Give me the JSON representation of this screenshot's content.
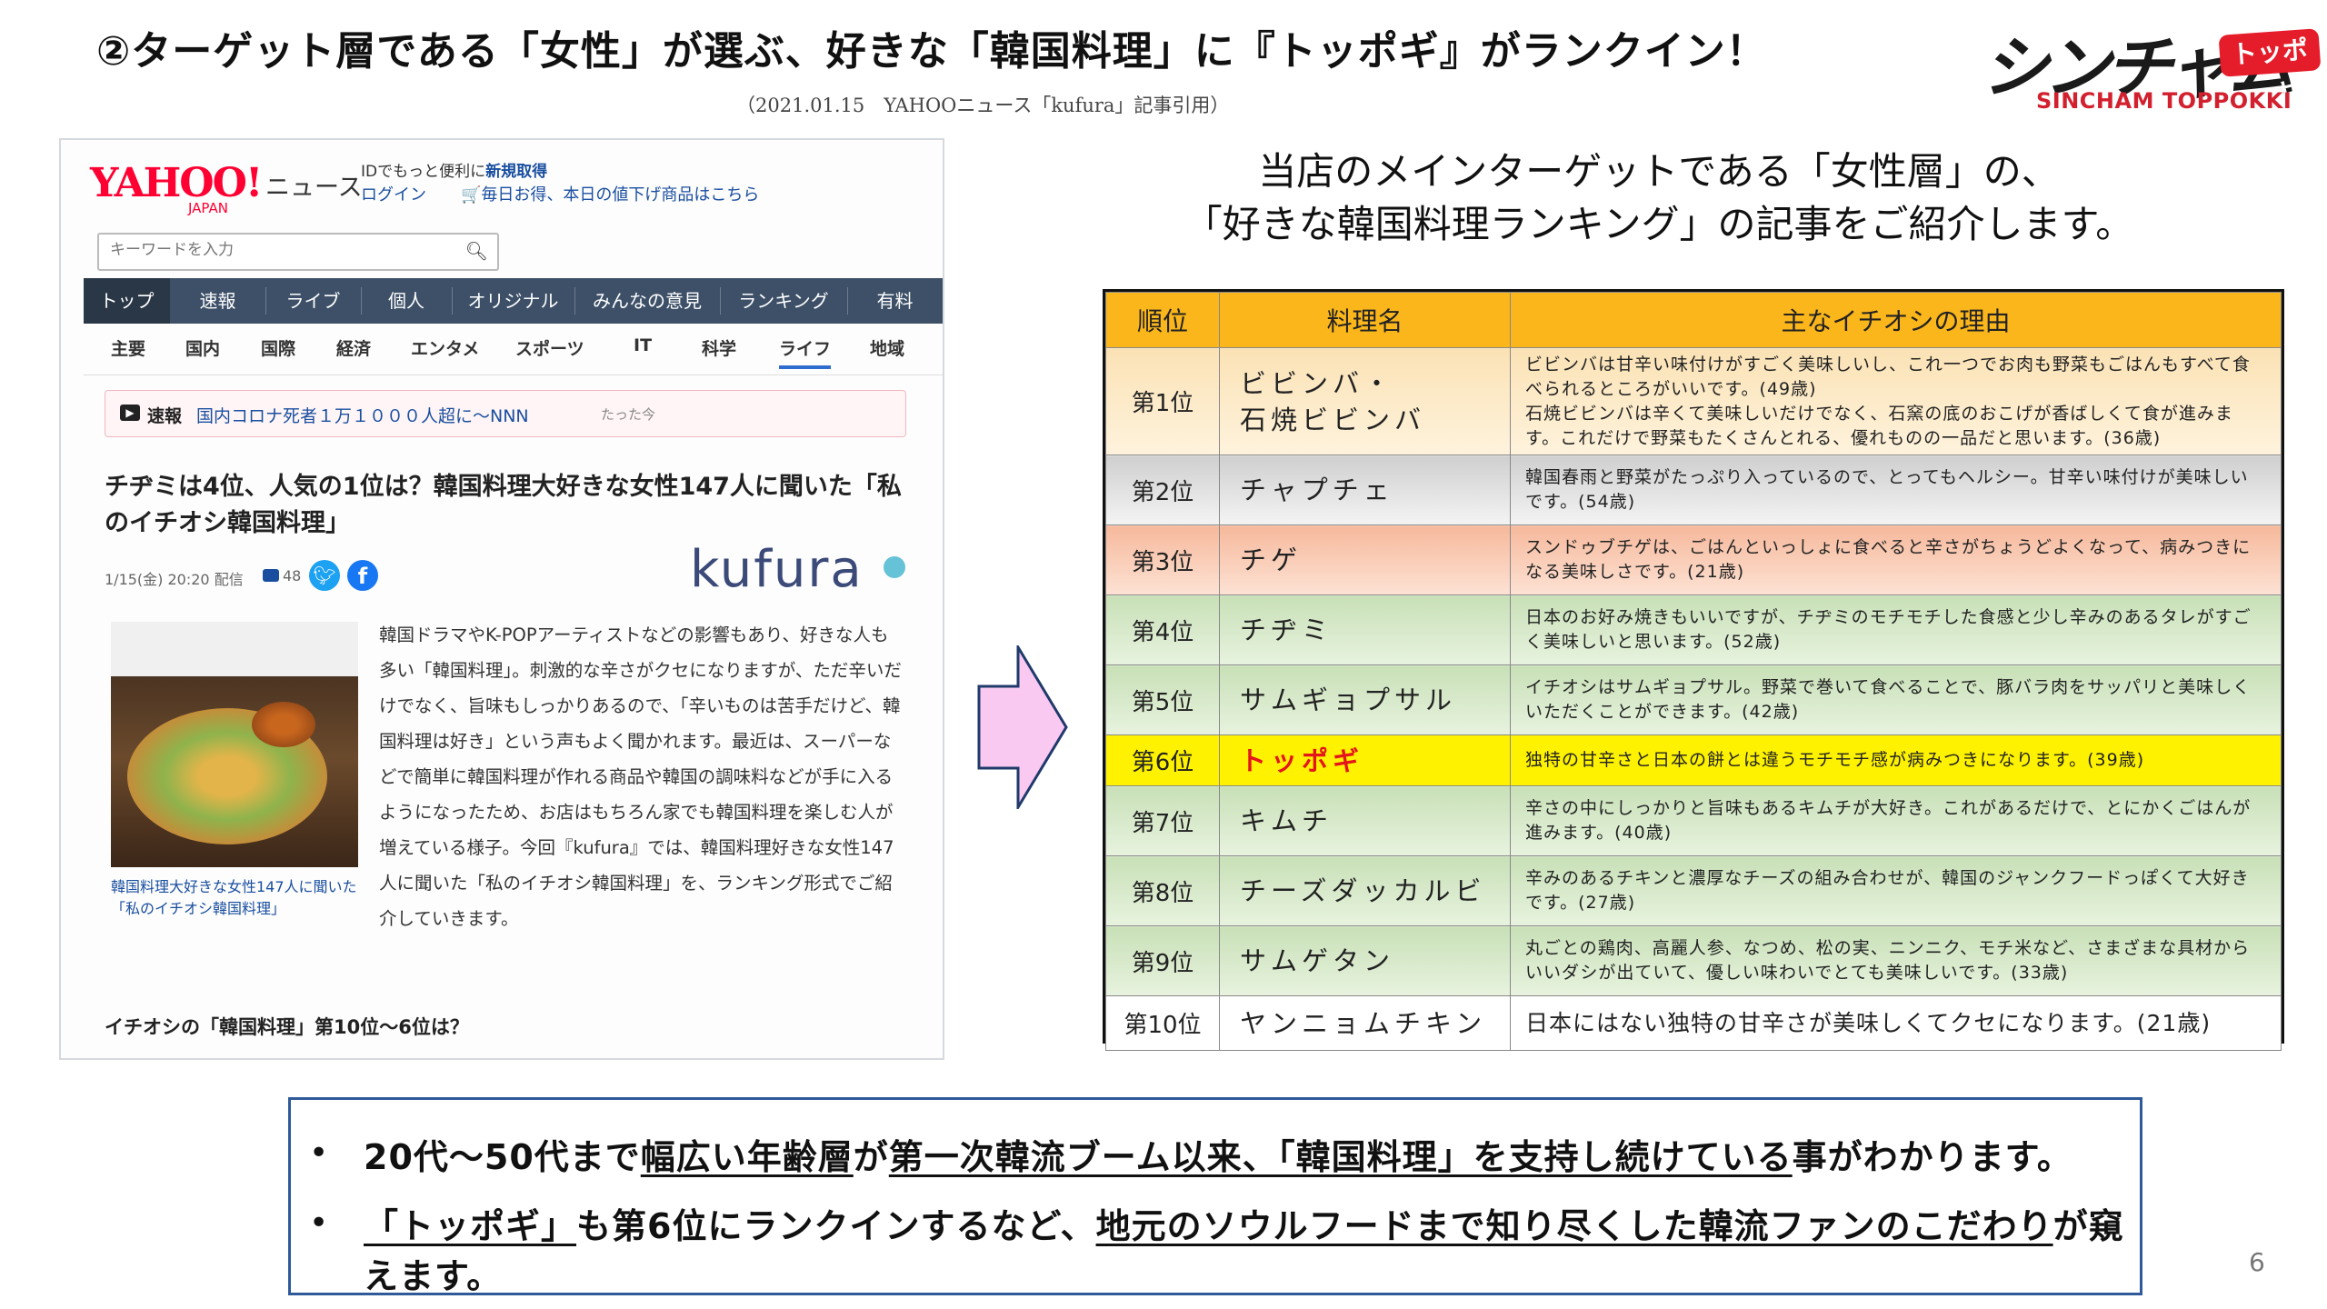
{
  "slide": {
    "title": "②ターゲット層である「女性」が選ぶ、好きな「韓国料理」に『トッポギ』がランクイン！",
    "citation": "（2021.01.15　YAHOOニュース「kufura」記事引用）",
    "page_number": "6"
  },
  "logo": {
    "wordmark": "シンチャム",
    "badge": "トッポッキ",
    "subtitle": "SINCHAM TOPPOKKI"
  },
  "article": {
    "brand": "YAHOO!",
    "brand_sub": "JAPAN",
    "section": "ニュース",
    "id_prompt": "IDでもっと便利に",
    "id_signup": "新規取得",
    "login": "ログイン",
    "promo": "毎日お得、本日の値下げ商品はこちら",
    "search_placeholder": "キーワードを入力",
    "nav": [
      "トップ",
      "速報",
      "ライブ",
      "個人",
      "オリジナル",
      "みんなの意見",
      "ランキング",
      "有料"
    ],
    "subnav": [
      "主要",
      "国内",
      "国際",
      "経済",
      "エンタメ",
      "スポーツ",
      "IT",
      "科学",
      "ライフ",
      "地域"
    ],
    "breaking_label": "速報",
    "breaking_text": "国内コロナ死者１万１０００人超に～NNN",
    "breaking_time": "たった今",
    "headline": "チヂミは4位、人気の1位は？韓国料理大好きな女性147人に聞いた「私のイチオシ韓国料理」",
    "meta": "1/15(金) 20:20 配信",
    "comment_count": "48",
    "source_logo": "kufura",
    "photo_caption": "韓国料理大好きな女性147人に聞いた「私のイチオシ韓国料理」",
    "body": "韓国ドラマやK-POPアーティストなどの影響もあり、好きな人も多い「韓国料理」。刺激的な辛さがクセになりますが、ただ辛いだけでなく、旨味もしっかりあるので、「辛いものは苦手だけど、韓国料理は好き」という声もよく聞かれます。最近は、スーパーなどで簡単に韓国料理が作れる商品や韓国の調味料などが手に入るようになったため、お店はもちろん家でも韓国料理を楽しむ人が増えている様子。今回『kufura』では、韓国料理好きな女性147人に聞いた「私のイチオシ韓国料理」を、ランキング形式でご紹介していきます。",
    "section_heading": "イチオシの「韓国料理」第10位～6位は？"
  },
  "intro": {
    "line1": "当店のメインターゲットである「女性層」の、",
    "line2": "「好きな韓国料理ランキング」の記事をご紹介します。"
  },
  "ranking": {
    "headers": [
      "順位",
      "料理名",
      "主なイチオシの理由"
    ],
    "rows": [
      {
        "rank": "第1位",
        "dish": "ビビンバ・\n石焼ビビンバ",
        "reason": "ビビンバは甘辛い味付けがすごく美味しいし、これ一つでお肉も野菜もごはんもすべて食べられるところがいいです。(49歳)\n石焼ビビンバは辛くて美味しいだけでなく、石窯の底のおこげが香ばしくて食が進みます。これだけで野菜もたくさんとれる、優れものの一品だと思います。(36歳)"
      },
      {
        "rank": "第2位",
        "dish": "チャプチェ",
        "reason": "韓国春雨と野菜がたっぷり入っているので、とってもヘルシー。甘辛い味付けが美味しいです。(54歳)"
      },
      {
        "rank": "第3位",
        "dish": "チゲ",
        "reason": "スンドゥブチゲは、ごはんといっしょに食べると辛さがちょうどよくなって、病みつきになる美味しさです。(21歳)"
      },
      {
        "rank": "第4位",
        "dish": "チヂミ",
        "reason": "日本のお好み焼きもいいですが、チヂミのモチモチした食感と少し辛みのあるタレがすごく美味しいと思います。(52歳)"
      },
      {
        "rank": "第5位",
        "dish": "サムギョプサル",
        "reason": "イチオシはサムギョプサル。野菜で巻いて食べることで、豚バラ肉をサッパリと美味しくいただくことができます。(42歳)"
      },
      {
        "rank": "第6位",
        "dish": "トッポギ",
        "reason": "独特の甘辛さと日本の餅とは違うモチモチ感が病みつきになります。(39歳)"
      },
      {
        "rank": "第7位",
        "dish": "キムチ",
        "reason": "辛さの中にしっかりと旨味もあるキムチが大好き。これがあるだけで、とにかくごはんが進みます。(40歳)"
      },
      {
        "rank": "第8位",
        "dish": "チーズダッカルビ",
        "reason": "辛みのあるチキンと濃厚なチーズの組み合わせが、韓国のジャンクフードっぽくて大好きです。(27歳)"
      },
      {
        "rank": "第9位",
        "dish": "サムゲタン",
        "reason": "丸ごとの鶏肉、高麗人参、なつめ、松の実、ニンニク、モチ米など、さまざまな具材からいいダシが出ていて、優しい味わいでとても美味しいです。(33歳)"
      },
      {
        "rank": "第10位",
        "dish": "ヤンニョムチキン",
        "reason": "日本にはない独特の甘辛さが美味しくてクセになります。(21歳)"
      }
    ]
  },
  "summary": {
    "bullet": "•",
    "line1_a": "20代～50代まで",
    "line1_b": "幅広い年齢層",
    "line1_c": "が",
    "line1_d": "第一次韓流ブーム以来、「韓国料理」を支持し続けている",
    "line1_e": "事がわかります。",
    "line2_a": "「トッポギ」",
    "line2_b": "も第6位にランクインするなど、",
    "line2_c": "地元のソウルフードまで知り尽くした韓流ファンのこだわり",
    "line2_d": "が窺えます。"
  },
  "colors": {
    "header_orange": "#fbb61b",
    "highlight_yellow": "#fff200",
    "highlight_red_text": "#e4141b",
    "arrow_pink": "#f9c9f1",
    "summary_border": "#2e5a9a"
  }
}
